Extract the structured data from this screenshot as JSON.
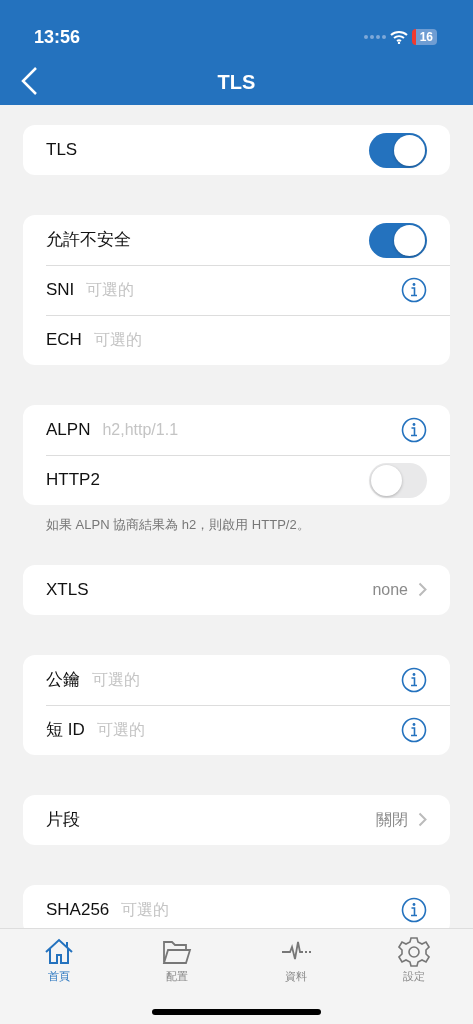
{
  "status_bar": {
    "time": "13:56",
    "battery": "16"
  },
  "nav_bar": {
    "title": "TLS"
  },
  "groups": [
    {
      "rows": [
        {
          "kind": "toggle",
          "label": "TLS",
          "on": true
        }
      ]
    },
    {
      "rows": [
        {
          "kind": "toggle",
          "label": "允許不安全",
          "on": true
        },
        {
          "kind": "field",
          "label": "SNI",
          "placeholder": "可選的",
          "info": true
        },
        {
          "kind": "field",
          "label": "ECH",
          "placeholder": "可選的",
          "info": false
        }
      ]
    },
    {
      "rows": [
        {
          "kind": "field",
          "label": "ALPN",
          "placeholder": "h2,http/1.1",
          "info": true
        },
        {
          "kind": "toggle",
          "label": "HTTP2",
          "on": false
        }
      ],
      "footer": "如果 ALPN 協商結果為 h2，則啟用 HTTP/2。"
    },
    {
      "rows": [
        {
          "kind": "link",
          "label": "XTLS",
          "value": "none"
        }
      ]
    },
    {
      "rows": [
        {
          "kind": "field",
          "label": "公鑰",
          "placeholder": "可選的",
          "info": true
        },
        {
          "kind": "field",
          "label": "短 ID",
          "placeholder": "可選的",
          "info": true
        }
      ]
    },
    {
      "rows": [
        {
          "kind": "link",
          "label": "片段",
          "value": "關閉"
        }
      ]
    },
    {
      "rows": [
        {
          "kind": "field",
          "label": "SHA256",
          "placeholder": "可選的",
          "info": true
        }
      ]
    }
  ],
  "tab_bar": [
    {
      "label": "首頁",
      "selected": true
    },
    {
      "label": "配置",
      "selected": false
    },
    {
      "label": "資料",
      "selected": false
    },
    {
      "label": "設定",
      "selected": false
    }
  ]
}
